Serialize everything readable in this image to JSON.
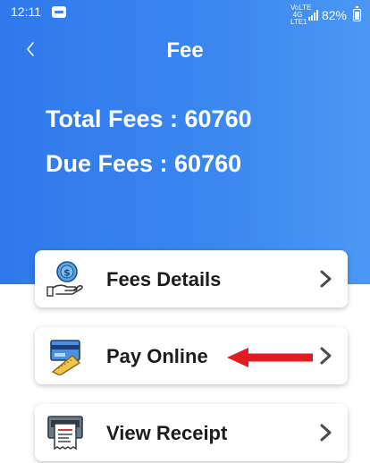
{
  "status_bar": {
    "time": "12:11",
    "network": "VoLTE 4G LTE1",
    "battery": "82%"
  },
  "header": {
    "title": "Fee",
    "back_icon": "chevron-left-icon"
  },
  "summary": {
    "total_fees": "Total Fees : 60760",
    "due_fees": "Due Fees : 60760"
  },
  "menu": {
    "items": [
      {
        "label": "Fees Details",
        "icon": "fees-details-icon"
      },
      {
        "label": "Pay Online",
        "icon": "pay-online-icon"
      },
      {
        "label": "View Receipt",
        "icon": "view-receipt-icon"
      }
    ]
  },
  "annotation": {
    "arrow_color": "#e11b22"
  },
  "colors": {
    "header_gradient_start": "#2f78ec",
    "header_gradient_end": "#4a97f4",
    "card_background": "#ffffff",
    "label_text": "#1c1c1c"
  }
}
